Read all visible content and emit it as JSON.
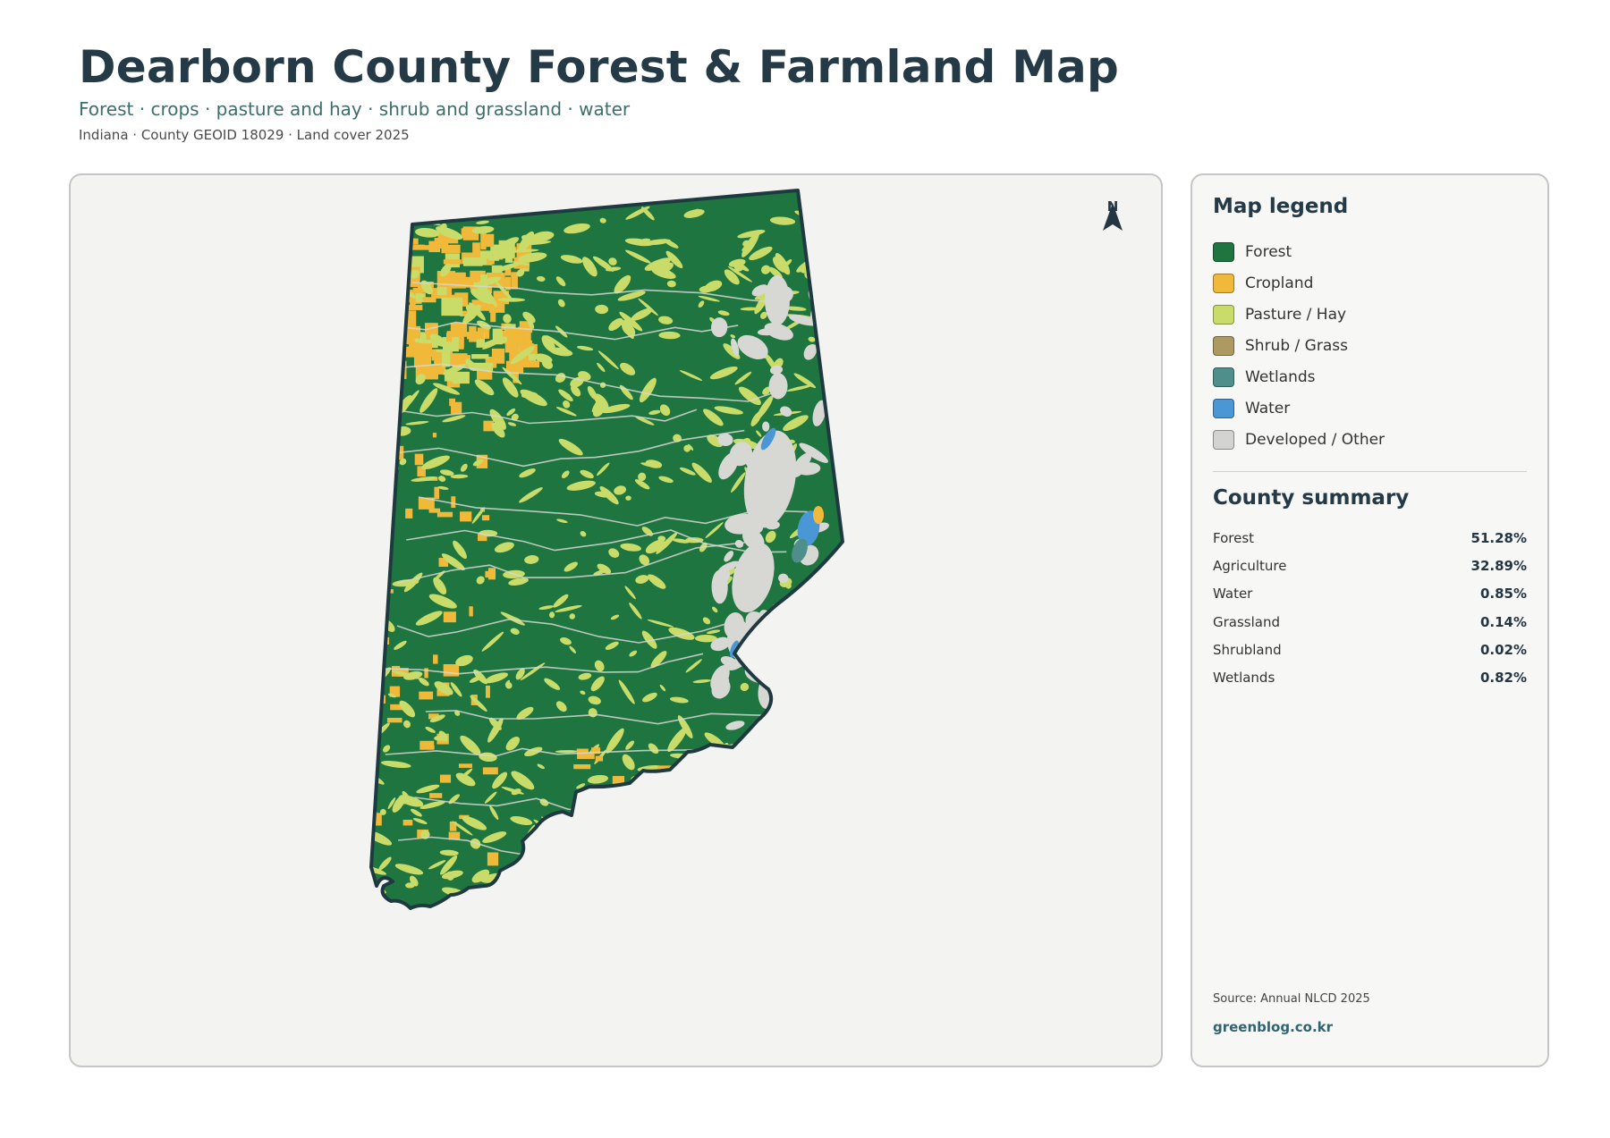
{
  "header": {
    "title": "Dearborn County Forest & Farmland Map",
    "subtitle": "Forest · crops · pasture and hay · shrub and grassland · water",
    "meta": "Indiana · County GEOID 18029 · Land cover 2025"
  },
  "map": {
    "north_label": "N",
    "north_icon": "north-arrow-icon",
    "colors": {
      "forest": "#1f7540",
      "cropland": "#f0b93a",
      "pasture": "#c9dc6a",
      "shrub": "#ac9a62",
      "wetlands": "#4e8f8c",
      "water": "#4b97d6",
      "developed": "#d7d7d4",
      "outline": "#1e3a40",
      "background": "#f3f3f2"
    }
  },
  "legend": {
    "title": "Map legend",
    "items": [
      {
        "label": "Forest",
        "color": "#1f7540"
      },
      {
        "label": "Cropland",
        "color": "#f0b93a"
      },
      {
        "label": "Pasture / Hay",
        "color": "#c9dc6a"
      },
      {
        "label": "Shrub / Grass",
        "color": "#ac9a62"
      },
      {
        "label": "Wetlands",
        "color": "#4e8f8c"
      },
      {
        "label": "Water",
        "color": "#4b97d6"
      },
      {
        "label": "Developed / Other",
        "color": "#d3d3d1"
      }
    ]
  },
  "summary": {
    "title": "County summary",
    "rows": [
      {
        "name": "Forest",
        "value": "51.28%"
      },
      {
        "name": "Agriculture",
        "value": "32.89%"
      },
      {
        "name": "Water",
        "value": "0.85%"
      },
      {
        "name": "Grassland",
        "value": "0.14%"
      },
      {
        "name": "Shrubland",
        "value": "0.02%"
      },
      {
        "name": "Wetlands",
        "value": "0.82%"
      }
    ]
  },
  "footer": {
    "source": "Source: Annual NLCD 2025",
    "brand": "greenblog.co.kr"
  }
}
